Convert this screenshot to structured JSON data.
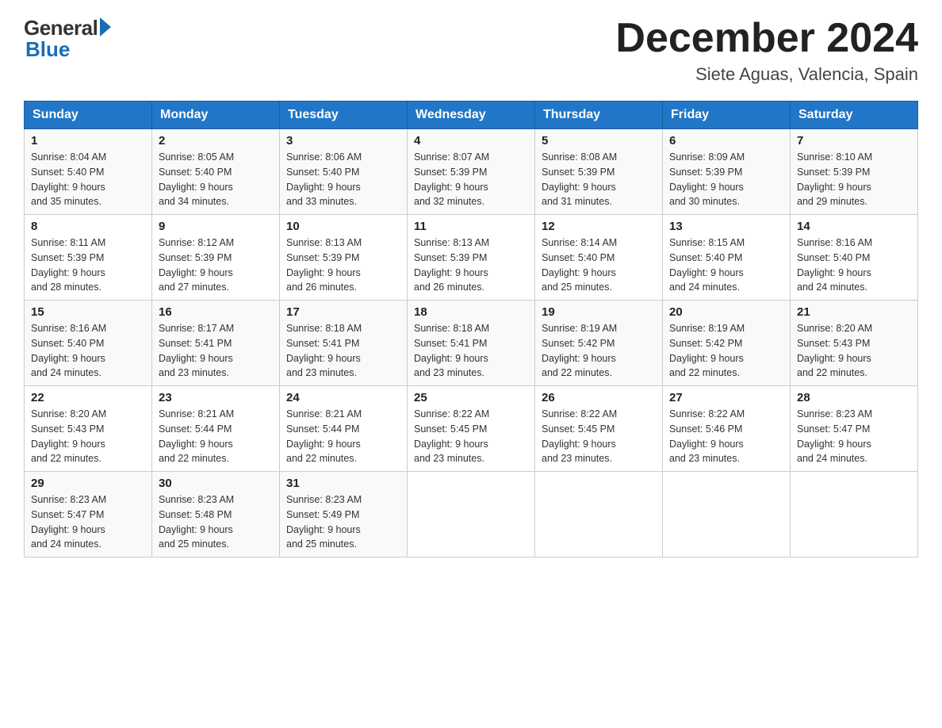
{
  "header": {
    "logo_general": "General",
    "logo_blue": "Blue",
    "month_title": "December 2024",
    "location": "Siete Aguas, Valencia, Spain"
  },
  "days_of_week": [
    "Sunday",
    "Monday",
    "Tuesday",
    "Wednesday",
    "Thursday",
    "Friday",
    "Saturday"
  ],
  "weeks": [
    [
      {
        "day": "1",
        "sunrise": "8:04 AM",
        "sunset": "5:40 PM",
        "daylight": "9 hours and 35 minutes."
      },
      {
        "day": "2",
        "sunrise": "8:05 AM",
        "sunset": "5:40 PM",
        "daylight": "9 hours and 34 minutes."
      },
      {
        "day": "3",
        "sunrise": "8:06 AM",
        "sunset": "5:40 PM",
        "daylight": "9 hours and 33 minutes."
      },
      {
        "day": "4",
        "sunrise": "8:07 AM",
        "sunset": "5:39 PM",
        "daylight": "9 hours and 32 minutes."
      },
      {
        "day": "5",
        "sunrise": "8:08 AM",
        "sunset": "5:39 PM",
        "daylight": "9 hours and 31 minutes."
      },
      {
        "day": "6",
        "sunrise": "8:09 AM",
        "sunset": "5:39 PM",
        "daylight": "9 hours and 30 minutes."
      },
      {
        "day": "7",
        "sunrise": "8:10 AM",
        "sunset": "5:39 PM",
        "daylight": "9 hours and 29 minutes."
      }
    ],
    [
      {
        "day": "8",
        "sunrise": "8:11 AM",
        "sunset": "5:39 PM",
        "daylight": "9 hours and 28 minutes."
      },
      {
        "day": "9",
        "sunrise": "8:12 AM",
        "sunset": "5:39 PM",
        "daylight": "9 hours and 27 minutes."
      },
      {
        "day": "10",
        "sunrise": "8:13 AM",
        "sunset": "5:39 PM",
        "daylight": "9 hours and 26 minutes."
      },
      {
        "day": "11",
        "sunrise": "8:13 AM",
        "sunset": "5:39 PM",
        "daylight": "9 hours and 26 minutes."
      },
      {
        "day": "12",
        "sunrise": "8:14 AM",
        "sunset": "5:40 PM",
        "daylight": "9 hours and 25 minutes."
      },
      {
        "day": "13",
        "sunrise": "8:15 AM",
        "sunset": "5:40 PM",
        "daylight": "9 hours and 24 minutes."
      },
      {
        "day": "14",
        "sunrise": "8:16 AM",
        "sunset": "5:40 PM",
        "daylight": "9 hours and 24 minutes."
      }
    ],
    [
      {
        "day": "15",
        "sunrise": "8:16 AM",
        "sunset": "5:40 PM",
        "daylight": "9 hours and 24 minutes."
      },
      {
        "day": "16",
        "sunrise": "8:17 AM",
        "sunset": "5:41 PM",
        "daylight": "9 hours and 23 minutes."
      },
      {
        "day": "17",
        "sunrise": "8:18 AM",
        "sunset": "5:41 PM",
        "daylight": "9 hours and 23 minutes."
      },
      {
        "day": "18",
        "sunrise": "8:18 AM",
        "sunset": "5:41 PM",
        "daylight": "9 hours and 23 minutes."
      },
      {
        "day": "19",
        "sunrise": "8:19 AM",
        "sunset": "5:42 PM",
        "daylight": "9 hours and 22 minutes."
      },
      {
        "day": "20",
        "sunrise": "8:19 AM",
        "sunset": "5:42 PM",
        "daylight": "9 hours and 22 minutes."
      },
      {
        "day": "21",
        "sunrise": "8:20 AM",
        "sunset": "5:43 PM",
        "daylight": "9 hours and 22 minutes."
      }
    ],
    [
      {
        "day": "22",
        "sunrise": "8:20 AM",
        "sunset": "5:43 PM",
        "daylight": "9 hours and 22 minutes."
      },
      {
        "day": "23",
        "sunrise": "8:21 AM",
        "sunset": "5:44 PM",
        "daylight": "9 hours and 22 minutes."
      },
      {
        "day": "24",
        "sunrise": "8:21 AM",
        "sunset": "5:44 PM",
        "daylight": "9 hours and 22 minutes."
      },
      {
        "day": "25",
        "sunrise": "8:22 AM",
        "sunset": "5:45 PM",
        "daylight": "9 hours and 23 minutes."
      },
      {
        "day": "26",
        "sunrise": "8:22 AM",
        "sunset": "5:45 PM",
        "daylight": "9 hours and 23 minutes."
      },
      {
        "day": "27",
        "sunrise": "8:22 AM",
        "sunset": "5:46 PM",
        "daylight": "9 hours and 23 minutes."
      },
      {
        "day": "28",
        "sunrise": "8:23 AM",
        "sunset": "5:47 PM",
        "daylight": "9 hours and 24 minutes."
      }
    ],
    [
      {
        "day": "29",
        "sunrise": "8:23 AM",
        "sunset": "5:47 PM",
        "daylight": "9 hours and 24 minutes."
      },
      {
        "day": "30",
        "sunrise": "8:23 AM",
        "sunset": "5:48 PM",
        "daylight": "9 hours and 25 minutes."
      },
      {
        "day": "31",
        "sunrise": "8:23 AM",
        "sunset": "5:49 PM",
        "daylight": "9 hours and 25 minutes."
      },
      null,
      null,
      null,
      null
    ]
  ],
  "labels": {
    "sunrise": "Sunrise:",
    "sunset": "Sunset:",
    "daylight": "Daylight:"
  }
}
